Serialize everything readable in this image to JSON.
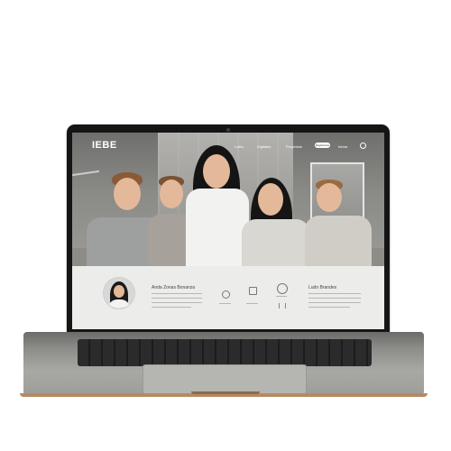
{
  "site": {
    "logo": "IEBE",
    "nav": [
      "Lotes",
      "Digitales",
      "Proyectos",
      "Iniciar"
    ],
    "nav_cta": "Registrarse"
  },
  "panel": {
    "left_title": "Anda Zonas Bonanza",
    "right_title": "Ludo Brandes"
  },
  "colors": {
    "lid": "#151515",
    "deck": "#9c9c98",
    "accent_edge": "#b58a63"
  }
}
